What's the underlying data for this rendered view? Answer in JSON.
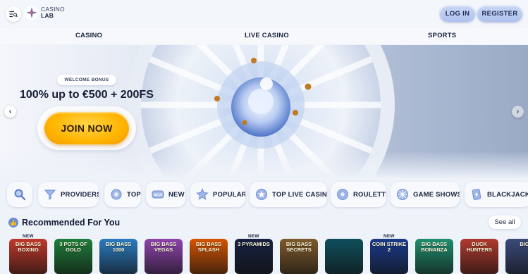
{
  "header": {
    "logo_line1": "CASINO",
    "logo_line2": "LAB",
    "login_label": "LOG IN",
    "register_label": "REGISTER"
  },
  "nav": {
    "items": [
      "CASINO",
      "LIVE CASINO",
      "SPORTS"
    ]
  },
  "banner": {
    "tag": "WELCOME BONUS",
    "headline": "100% up to €500 + 200FS",
    "cta": "JOIN NOW"
  },
  "categories": [
    {
      "label": "",
      "icon": "search-icon"
    },
    {
      "label": "PROVIDERS",
      "icon": "providers-icon"
    },
    {
      "label": "TOP",
      "icon": "top-icon"
    },
    {
      "label": "NEW",
      "icon": "new-icon"
    },
    {
      "label": "POPULAR",
      "icon": "star-icon"
    },
    {
      "label": "TOP LIVE CASINO",
      "icon": "live-casino-icon"
    },
    {
      "label": "ROULETTE",
      "icon": "roulette-icon"
    },
    {
      "label": "GAME SHOWS",
      "icon": "game-shows-icon"
    },
    {
      "label": "BLACKJACK",
      "icon": "blackjack-icon"
    }
  ],
  "recommended": {
    "title": "Recommended For You",
    "see_all": "See all",
    "new_badge": "NEW",
    "games": [
      {
        "title": "BIG BASS BOXING",
        "color": "#c0392b",
        "is_new": true
      },
      {
        "title": "3 POTS OF GOLD",
        "color": "#1e7d3a",
        "is_new": false
      },
      {
        "title": "BIG BASS 1000",
        "color": "#2b7bbf",
        "is_new": false
      },
      {
        "title": "BIG BASS VEGAS",
        "color": "#8e44ad",
        "is_new": false
      },
      {
        "title": "BIG BASS SPLASH",
        "color": "#d35400",
        "is_new": false
      },
      {
        "title": "3 PYRAMIDS",
        "color": "#16213e",
        "is_new": true
      },
      {
        "title": "BIG BASS SECRETS",
        "color": "#7d5a2b",
        "is_new": false
      },
      {
        "title": "",
        "color": "#0e4f5c",
        "is_new": false
      },
      {
        "title": "COIN STRIKE 2",
        "color": "#1a3b8a",
        "is_new": true
      },
      {
        "title": "BIG BASS BONANZA",
        "color": "#1f8f6e",
        "is_new": false
      },
      {
        "title": "DUCK HUNTERS",
        "color": "#b03a2e",
        "is_new": false
      },
      {
        "title": "BIG",
        "color": "#3b4a7a",
        "is_new": false
      }
    ]
  },
  "colors": {
    "accent_button": "#aec2ee",
    "cta": "#ffb400",
    "background": "#eef2f9"
  }
}
